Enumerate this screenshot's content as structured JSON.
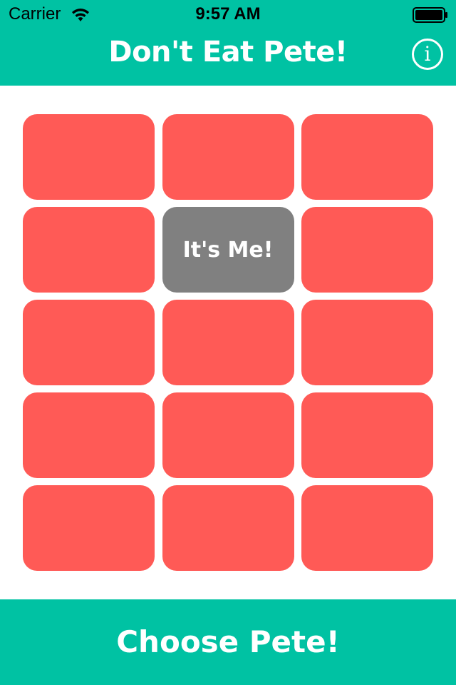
{
  "status_bar": {
    "carrier": "Carrier",
    "time": "9:57 AM",
    "wifi_icon": "wifi-icon",
    "battery_icon": "battery-full-icon"
  },
  "header": {
    "title": "Don't Eat Pete!",
    "info_glyph": "i",
    "info_icon": "info-icon",
    "background_color": "#00c2a3"
  },
  "grid": {
    "columns": 3,
    "rows": 5,
    "card_color": "#ff5a56",
    "revealed_color": "#808080",
    "cards": [
      {
        "label": "",
        "revealed": false
      },
      {
        "label": "",
        "revealed": false
      },
      {
        "label": "",
        "revealed": false
      },
      {
        "label": "",
        "revealed": false
      },
      {
        "label": "It's Me!",
        "revealed": true
      },
      {
        "label": "",
        "revealed": false
      },
      {
        "label": "",
        "revealed": false
      },
      {
        "label": "",
        "revealed": false
      },
      {
        "label": "",
        "revealed": false
      },
      {
        "label": "",
        "revealed": false
      },
      {
        "label": "",
        "revealed": false
      },
      {
        "label": "",
        "revealed": false
      },
      {
        "label": "",
        "revealed": false
      },
      {
        "label": "",
        "revealed": false
      },
      {
        "label": "",
        "revealed": false
      }
    ]
  },
  "footer": {
    "button_label": "Choose Pete!",
    "background_color": "#00c2a3"
  }
}
